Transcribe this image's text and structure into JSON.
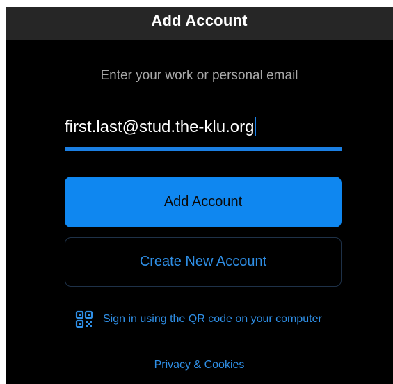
{
  "header": {
    "title": "Add Account"
  },
  "form": {
    "prompt": "Enter your work or personal email",
    "email_value": "first.last@stud.the-klu.org",
    "add_account_label": "Add Account",
    "create_account_label": "Create New Account",
    "qr_sign_in_label": "Sign in using the QR code on your computer",
    "qr_icon": "qr-code-icon"
  },
  "footer": {
    "privacy_label": "Privacy & Cookies"
  },
  "colors": {
    "background": "#000000",
    "titlebar": "#262626",
    "accent": "#0f87f0",
    "link": "#2f8fe6",
    "prompt_text": "#a8a8a8"
  }
}
